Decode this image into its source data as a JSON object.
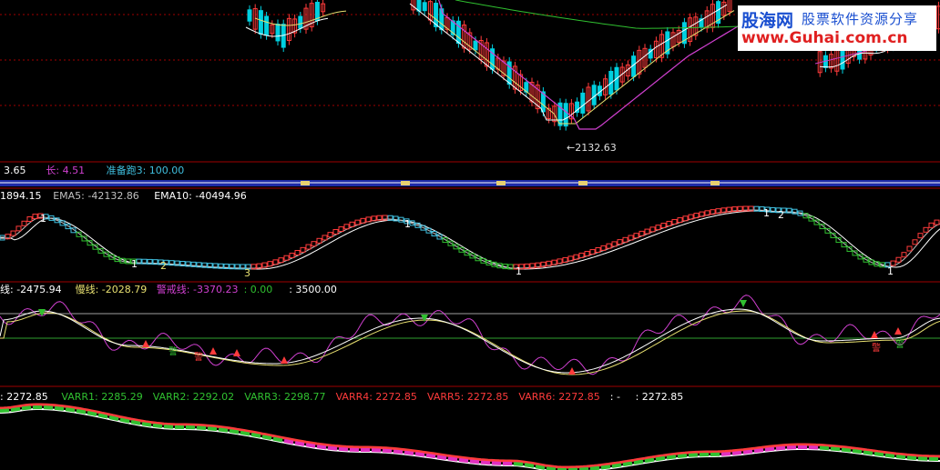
{
  "watermark": {
    "brand": "股海网",
    "slogan": "股票软件资源分享",
    "url": "www.Guhai.com.cn"
  },
  "colors": {
    "up": "#ff3b3b",
    "down": "#00d0e0",
    "ma_white": "#ffffff",
    "ma_yellow": "#e8e070",
    "ma_magenta": "#d040d0",
    "ma_green": "#30c030",
    "grid": "#a00000"
  },
  "panel1": {
    "price_low_label": "←2132.63",
    "legend": [
      {
        "text": "3.65",
        "color": "#ffffff"
      },
      {
        "text": "长: 4.51",
        "color": "#d040d0"
      },
      {
        "text": "准备跑3: 100.00",
        "color": "#40c0e0"
      }
    ]
  },
  "panel2": {
    "legend": [
      {
        "text": "1894.15",
        "color": "#ffffff"
      },
      {
        "text": "EMA5: -42132.86",
        "color": "#c0c0c0"
      },
      {
        "text": "EMA10: -40494.96",
        "color": "#ffffff"
      }
    ],
    "markers": [
      "1",
      "1",
      "2",
      "3",
      "1",
      "1",
      "1",
      "2",
      "1"
    ]
  },
  "panel3": {
    "legend": [
      {
        "text": "线: -2475.94",
        "color": "#ffffff"
      },
      {
        "text": "慢线: -2028.79",
        "color": "#e8e070"
      },
      {
        "text": "警戒线: -3370.23",
        "color": "#d040d0"
      },
      {
        "text": ": 0.00",
        "color": "#30c030"
      },
      {
        "text": ": 3500.00",
        "color": "#ffffff"
      }
    ],
    "signal_char": "警"
  },
  "panel4": {
    "legend": [
      {
        "text": ": 2272.85",
        "color": "#ffffff"
      },
      {
        "text": "VARR1: 2285.29",
        "color": "#30c030"
      },
      {
        "text": "VARR2: 2292.02",
        "color": "#30c030"
      },
      {
        "text": "VARR3: 2298.77",
        "color": "#30c030"
      },
      {
        "text": "VARR4: 2272.85",
        "color": "#ff3b3b"
      },
      {
        "text": "VARR5: 2272.85",
        "color": "#ff3b3b"
      },
      {
        "text": "VARR6: 2272.85",
        "color": "#ff3b3b"
      },
      {
        "text": ": -",
        "color": "#ffffff"
      },
      {
        "text": ": 2272.85",
        "color": "#ffffff"
      }
    ]
  },
  "chart_data": [
    {
      "type": "candlestick",
      "title": "",
      "notes": "Main price panel with candlesticks and moving averages",
      "min_label": "2132.63"
    },
    {
      "type": "line",
      "series": [
        {
          "name": "EMA5"
        },
        {
          "name": "EMA10"
        }
      ],
      "markers": [
        "1",
        "1",
        "2",
        "3",
        "1",
        "1",
        "1",
        "2",
        "1"
      ]
    },
    {
      "type": "line",
      "series": [
        {
          "name": "慢线"
        },
        {
          "name": "警戒线"
        }
      ],
      "levels": [
        0,
        3500
      ]
    },
    {
      "type": "line",
      "series": [
        {
          "name": "VARR1"
        },
        {
          "name": "VARR2"
        },
        {
          "name": "VARR3"
        },
        {
          "name": "VARR4"
        },
        {
          "name": "VARR5"
        },
        {
          "name": "VARR6"
        }
      ]
    }
  ]
}
